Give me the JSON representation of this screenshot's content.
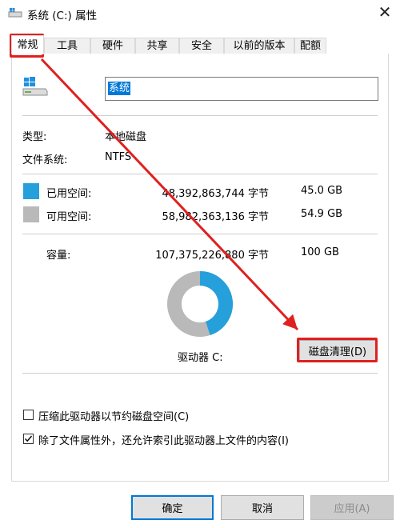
{
  "window": {
    "title": "系统 (C:) 属性",
    "close_glyph": "✕"
  },
  "tabs": [
    {
      "label": "常规",
      "active": true
    },
    {
      "label": "工具"
    },
    {
      "label": "硬件"
    },
    {
      "label": "共享"
    },
    {
      "label": "安全"
    },
    {
      "label": "以前的版本"
    },
    {
      "label": "配额"
    }
  ],
  "general": {
    "volume_name": "系统",
    "type_label": "类型:",
    "type_value": "本地磁盘",
    "fs_label": "文件系统:",
    "fs_value": "NTFS",
    "used": {
      "label": "已用空间:",
      "bytes": "48,392,863,744 字节",
      "size": "45.0 GB",
      "color": "#26a0da"
    },
    "free": {
      "label": "可用空间:",
      "bytes": "58,982,363,136 字节",
      "size": "54.9 GB",
      "color": "#b9b9b9"
    },
    "capacity": {
      "label": "容量:",
      "bytes": "107,375,226,880 字节",
      "size": "100 GB"
    },
    "drive_label": "驱动器 C:",
    "cleanup_button": "磁盘清理(D)",
    "used_fraction": 0.45
  },
  "options": [
    {
      "label": "压缩此驱动器以节约磁盘空间(C)",
      "checked": false
    },
    {
      "label": "除了文件属性外，还允许索引此驱动器上文件的内容(I)",
      "checked": true
    }
  ],
  "buttons": {
    "ok": "确定",
    "cancel": "取消",
    "apply": "应用(A)"
  },
  "annotation_color": "#e02020"
}
